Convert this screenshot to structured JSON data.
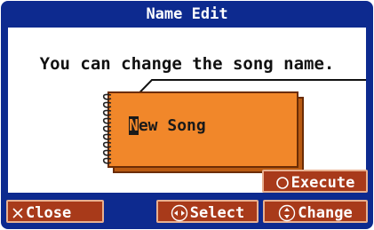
{
  "dialog": {
    "title": "Name Edit",
    "message": "You can change the song name.",
    "song_name_first": "N",
    "song_name_rest": "ew Song"
  },
  "buttons": {
    "execute": "Execute",
    "close": "Close",
    "select": "Select",
    "change": "Change"
  },
  "icons": {
    "execute": "circle-icon",
    "close": "x-icon",
    "select": "left-right-arrows-icon",
    "change": "up-down-arrows-icon"
  },
  "colors": {
    "screen_bg": "#0d2a8f",
    "panel_bg": "#ffffff",
    "notebook": "#f1872a",
    "button_bg": "#a83a1a"
  }
}
